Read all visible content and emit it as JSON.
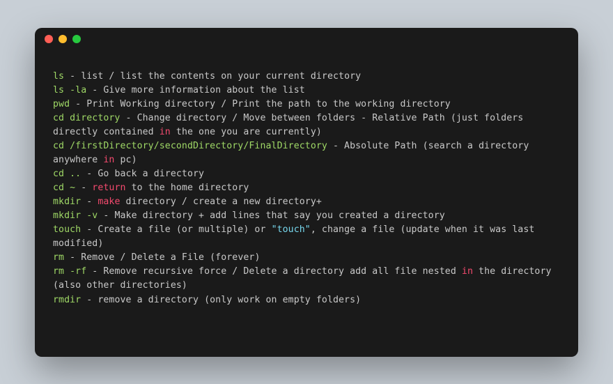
{
  "lines": [
    [
      {
        "type": "cmd",
        "text": "ls"
      },
      {
        "type": "plain",
        "text": " - list / list the contents on your current directory"
      }
    ],
    [
      {
        "type": "cmd",
        "text": "ls -la"
      },
      {
        "type": "plain",
        "text": " - Give more information about the list"
      }
    ],
    [
      {
        "type": "cmd",
        "text": "pwd"
      },
      {
        "type": "plain",
        "text": " - Print Working directory / Print the path to the working directory"
      }
    ],
    [
      {
        "type": "cmd",
        "text": "cd directory"
      },
      {
        "type": "plain",
        "text": " - Change directory / Move between folders - Relative Path (just folders directly contained "
      },
      {
        "type": "kw",
        "text": "in"
      },
      {
        "type": "plain",
        "text": " the one you are currently)"
      }
    ],
    [
      {
        "type": "cmd",
        "text": "cd /firstDirectory/secondDirectory/FinalDirectory"
      },
      {
        "type": "plain",
        "text": " - Absolute Path (search a directory anywhere "
      },
      {
        "type": "kw",
        "text": "in"
      },
      {
        "type": "plain",
        "text": " pc)"
      }
    ],
    [
      {
        "type": "cmd",
        "text": "cd .."
      },
      {
        "type": "plain",
        "text": " - Go back a directory"
      }
    ],
    [
      {
        "type": "cmd",
        "text": "cd ~"
      },
      {
        "type": "plain",
        "text": " - "
      },
      {
        "type": "kw",
        "text": "return"
      },
      {
        "type": "plain",
        "text": " to the home directory"
      }
    ],
    [
      {
        "type": "cmd",
        "text": "mkdir"
      },
      {
        "type": "plain",
        "text": " - "
      },
      {
        "type": "kw",
        "text": "make"
      },
      {
        "type": "plain",
        "text": " directory / create a new directory+"
      }
    ],
    [
      {
        "type": "cmd",
        "text": "mkdir -v"
      },
      {
        "type": "plain",
        "text": " - Make directory + add lines that say you created a directory"
      }
    ],
    [
      {
        "type": "cmd",
        "text": "touch"
      },
      {
        "type": "plain",
        "text": " - Create a file (or multiple) or "
      },
      {
        "type": "str",
        "text": "\"touch\""
      },
      {
        "type": "plain",
        "text": ", change a file (update when it was last modified)"
      }
    ],
    [
      {
        "type": "cmd",
        "text": "rm"
      },
      {
        "type": "plain",
        "text": " - Remove / Delete a File (forever)"
      }
    ],
    [
      {
        "type": "cmd",
        "text": "rm -rf"
      },
      {
        "type": "plain",
        "text": " - Remove recursive force / Delete a directory add all file nested "
      },
      {
        "type": "kw",
        "text": "in"
      },
      {
        "type": "plain",
        "text": " the directory (also other directories)"
      }
    ],
    [
      {
        "type": "cmd",
        "text": "rmdir"
      },
      {
        "type": "plain",
        "text": " - remove a directory (only work on empty folders)"
      }
    ]
  ]
}
